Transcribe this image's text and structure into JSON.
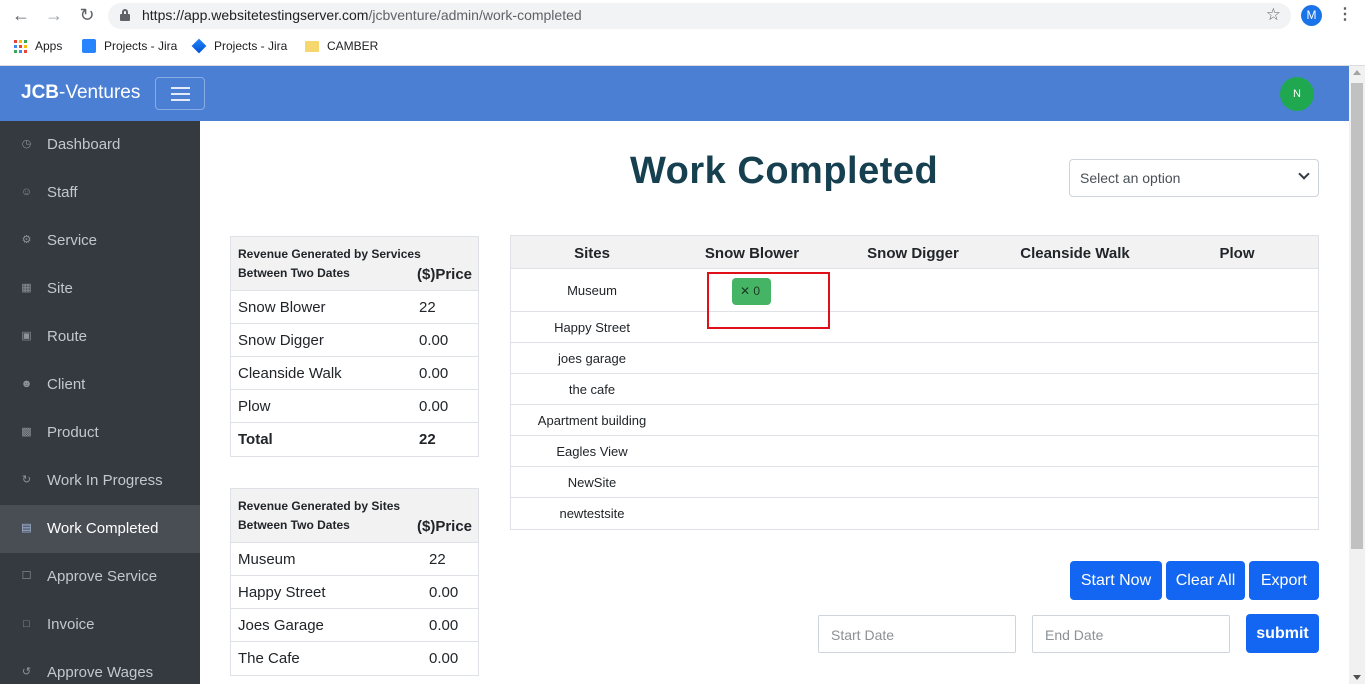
{
  "browser": {
    "url_host": "https://app.websitetestingserver.com",
    "url_path": "/jcbventure/admin/work-completed",
    "profile_initial": "M",
    "bookmarks": [
      {
        "label": "Apps",
        "icon": "apps-grid-icon"
      },
      {
        "label": "Projects - Jira",
        "icon": "jira-icon"
      },
      {
        "label": "Projects - Jira",
        "icon": "jira-icon"
      },
      {
        "label": "CAMBER",
        "icon": "folder-icon"
      }
    ]
  },
  "header": {
    "brand_bold": "JCB",
    "brand_rest": "-Ventures",
    "avatar_initial": "N",
    "bar_color": "#4a7fd4"
  },
  "sidebar": {
    "items": [
      {
        "label": "Dashboard",
        "icon": "dashboard-icon"
      },
      {
        "label": "Staff",
        "icon": "user-icon"
      },
      {
        "label": "Service",
        "icon": "service-icon"
      },
      {
        "label": "Site",
        "icon": "site-icon"
      },
      {
        "label": "Route",
        "icon": "route-icon"
      },
      {
        "label": "Client",
        "icon": "client-icon"
      },
      {
        "label": "Product",
        "icon": "product-icon"
      },
      {
        "label": "Work In Progress",
        "icon": "refresh-icon"
      },
      {
        "label": "Work Completed",
        "icon": "store-icon",
        "active": true
      },
      {
        "label": "Approve Service",
        "icon": "approve-icon"
      },
      {
        "label": "Invoice",
        "icon": "invoice-icon"
      },
      {
        "label": "Approve Wages",
        "icon": "history-icon"
      }
    ]
  },
  "main": {
    "title": "Work Completed",
    "select_placeholder": "Select an option",
    "revenue_services": {
      "title": "Revenue Generated by Services Between Two Dates",
      "price_header": "($)Price",
      "rows": [
        {
          "name": "Snow Blower",
          "value": "22"
        },
        {
          "name": "Snow Digger",
          "value": "0.00"
        },
        {
          "name": "Cleanside Walk",
          "value": "0.00"
        },
        {
          "name": "Plow",
          "value": "0.00"
        }
      ],
      "total_label": "Total",
      "total_value": "22"
    },
    "revenue_sites": {
      "title": "Revenue Generated by Sites Between Two Dates",
      "price_header": "($)Price",
      "rows": [
        {
          "name": "Museum",
          "value": "22"
        },
        {
          "name": "Happy Street",
          "value": "0.00"
        },
        {
          "name": "Joes Garage",
          "value": "0.00"
        },
        {
          "name": "The Cafe",
          "value": "0.00"
        }
      ]
    },
    "sites_table": {
      "columns": [
        "Sites",
        "Snow Blower",
        "Snow Digger",
        "Cleanside Walk",
        "Plow"
      ],
      "rows": [
        "Museum",
        "Happy Street",
        "joes garage",
        "the cafe",
        "Apartment building",
        "Eagles View",
        "NewSite",
        "newtestsite"
      ],
      "badge": {
        "site": "Museum",
        "service": "Snow Blower",
        "icon": "close-icon",
        "count": "0"
      }
    },
    "buttons": {
      "start_now": "Start Now",
      "clear_all": "Clear All",
      "export": "Export",
      "submit": "submit"
    },
    "date_inputs": {
      "start_placeholder": "Start Date",
      "end_placeholder": "End Date"
    }
  }
}
